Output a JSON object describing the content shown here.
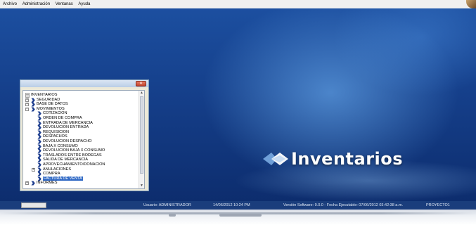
{
  "menu": {
    "items": [
      "Archivo",
      "Administración",
      "Ventanas",
      "Ayuda"
    ]
  },
  "brand": {
    "text": "Inventarios"
  },
  "tree": {
    "items": [
      {
        "label": "INVENTARIOS",
        "level": 0,
        "expander": "-"
      },
      {
        "label": "SEGURIDAD",
        "level": 1,
        "expander": "+"
      },
      {
        "label": "BASE DE DATOS",
        "level": 1,
        "expander": "+"
      },
      {
        "label": "MOVIMIENTOS",
        "level": 1,
        "expander": "-"
      },
      {
        "label": "COTIZACION",
        "level": 2
      },
      {
        "label": "ORDEN DE COMPRA",
        "level": 2
      },
      {
        "label": "ENTRADA DE MERCANCIA",
        "level": 2
      },
      {
        "label": "DEVOLUCION ENTRADA",
        "level": 2
      },
      {
        "label": "REQUISICION",
        "level": 2
      },
      {
        "label": "DESPACHOS",
        "level": 2
      },
      {
        "label": "DEVOLUCION DESPACHO",
        "level": 2
      },
      {
        "label": "BAJA X CONSUMO",
        "level": 2
      },
      {
        "label": "DEVOLUCION BAJA X CONSUMO",
        "level": 2
      },
      {
        "label": "TRASLADOS ENTRE BODEGAS",
        "level": 2
      },
      {
        "label": "SALIDA DE MERCANCIA",
        "level": 2
      },
      {
        "label": "APROVECHAMIENTO/DONACION",
        "level": 2
      },
      {
        "label": "ANULACIONES",
        "level": 2,
        "expander": "+"
      },
      {
        "label": "COMPRA",
        "level": 2
      },
      {
        "label": "FACTURA DE VENTA",
        "level": 2,
        "selected": true
      },
      {
        "label": "INFORMES",
        "level": 1,
        "expander": "+"
      }
    ]
  },
  "status": {
    "user": "Usuario: ADMINISTRADOR",
    "datetime": "14/06/2012 10:24 PM",
    "version": "Versión Software: 9.0.0 - Fecha Ejecutable: 07/06/2012 03:42:38 a.m.",
    "project": "PROYECTO1"
  },
  "colors": {
    "desktop": "#153f8a",
    "selection": "#316ac5",
    "chevron": "#1f3f8f"
  }
}
